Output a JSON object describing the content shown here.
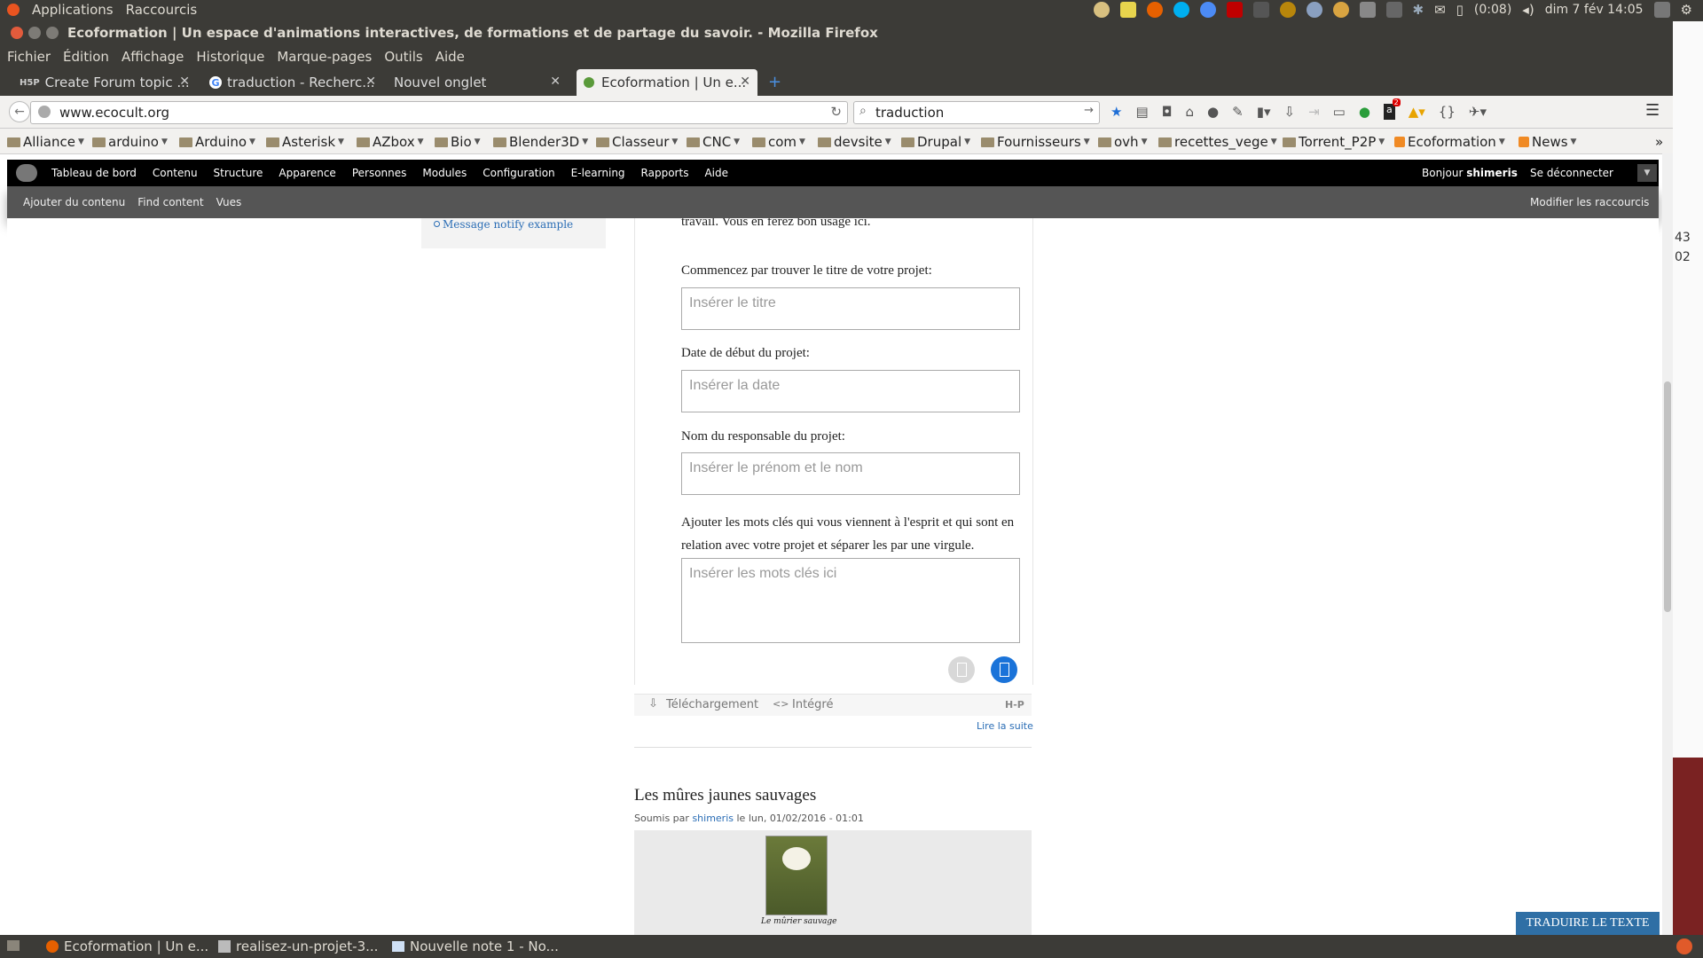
{
  "system_panel": {
    "applications": "Applications",
    "shortcuts": "Raccourcis",
    "battery": "(0:08)",
    "clock": "dim 7 fév 14:05"
  },
  "window": {
    "title": "Ecoformation | Un espace d'animations interactives, de formations et de partage du savoir. - Mozilla Firefox"
  },
  "menubar": [
    "Fichier",
    "Édition",
    "Affichage",
    "Historique",
    "Marque-pages",
    "Outils",
    "Aide"
  ],
  "tabs": [
    {
      "label": "Create Forum topic ...",
      "favicon": "h5p-icon"
    },
    {
      "label": "traduction - Recherc...",
      "favicon": "google-icon"
    },
    {
      "label": "Nouvel onglet",
      "favicon": ""
    },
    {
      "label": "Ecoformation | Un e...",
      "favicon": "ecoformation-icon"
    }
  ],
  "navbar": {
    "url": "www.ecocult.org",
    "search": "traduction",
    "badge": "2"
  },
  "bookmarks": [
    "Alliance",
    "arduino",
    "Arduino",
    "Asterisk",
    "AZbox",
    "Bio",
    "Blender3D",
    "Classeur",
    "CNC",
    "com",
    "devsite",
    "Drupal",
    "Fournisseurs",
    "ovh",
    "recettes_vege",
    "Torrent_P2P",
    "Ecoformation",
    "News"
  ],
  "admin_menu": {
    "items": [
      "Tableau de bord",
      "Contenu",
      "Structure",
      "Apparence",
      "Personnes",
      "Modules",
      "Configuration",
      "E-learning",
      "Rapports",
      "Aide"
    ],
    "greeting": "Bonjour",
    "user": "shimeris",
    "logout": "Se déconnecter"
  },
  "shortcuts": {
    "items": [
      "Ajouter du contenu",
      "Find content",
      "Vues"
    ],
    "edit": "Modifier les raccourcis"
  },
  "sidebar": {
    "link": "Message notify example"
  },
  "h5p": {
    "intro_tail": "travail. Vous en ferez bon usage ici.",
    "fields": [
      {
        "label": "Commencez par trouver le titre de votre projet:",
        "placeholder": "Insérer le titre"
      },
      {
        "label": "Date de début du projet:",
        "placeholder": "Insérer la date"
      },
      {
        "label": "Nom du responsable du projet:",
        "placeholder": "Insérer le prénom et le nom"
      },
      {
        "label": "Ajouter les mots clés qui vous viennent à l'esprit et qui sont en relation avec votre projet et séparer les par une virgule.",
        "placeholder": "Insérer les mots clés ici"
      }
    ],
    "footer": {
      "download": "Téléchargement",
      "embed": "Intégré",
      "logo": "H-P"
    },
    "read_more": "Lire la suite"
  },
  "article": {
    "title": "Les mûres jaunes sauvages",
    "submitted_by": "Soumis par",
    "author": "shimeris",
    "date": "le lun, 01/02/2016 - 01:01",
    "caption": "Le mûrier sauvage"
  },
  "translate_button": "TRADUIRE LE TEXTE",
  "right_edge": [
    "43",
    "02"
  ],
  "taskbar": [
    {
      "label": "Ecoformation | Un e...",
      "icon": "firefox-icon"
    },
    {
      "label": "realisez-un-projet-3...",
      "icon": "document-icon"
    },
    {
      "label": "Nouvelle note 1 - No...",
      "icon": "note-icon"
    }
  ],
  "colors": {
    "panel": "#3c3b37",
    "admin": "#000000",
    "accent": "#2a6db5",
    "h5p_blue": "#1a73d9"
  }
}
